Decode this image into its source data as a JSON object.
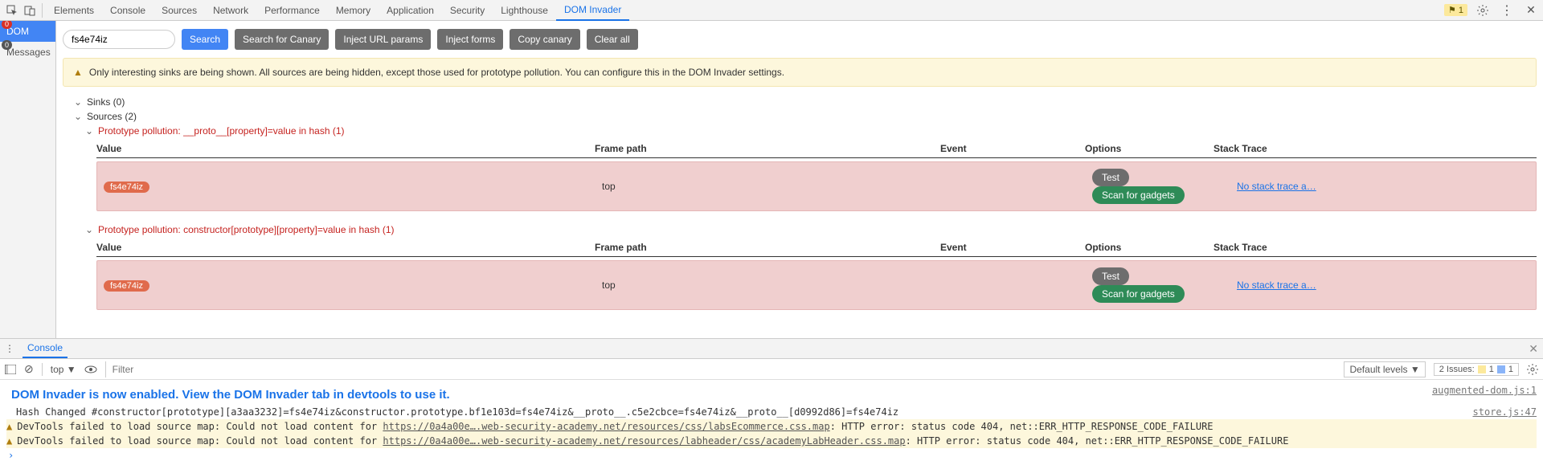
{
  "tabs": [
    "Elements",
    "Console",
    "Sources",
    "Network",
    "Performance",
    "Memory",
    "Application",
    "Security",
    "Lighthouse",
    "DOM Invader"
  ],
  "active_tab": "DOM Invader",
  "top_badge": "1",
  "sidebar": {
    "dom": {
      "label": "DOM",
      "badge": "0"
    },
    "messages": {
      "label": "Messages",
      "badge": "0"
    }
  },
  "toolbar": {
    "search_value": "fs4e74iz",
    "search_label": "Search",
    "canary_label": "Search for Canary",
    "inject_url_label": "Inject URL params",
    "inject_forms_label": "Inject forms",
    "copy_canary_label": "Copy canary",
    "clear_label": "Clear all"
  },
  "banner": "Only interesting sinks are being shown. All sources are being hidden, except those used for prototype pollution. You can configure this in the DOM Invader settings.",
  "tree": {
    "sinks": "Sinks (0)",
    "sources": "Sources (2)",
    "pp1": "Prototype pollution: __proto__[property]=value in hash (1)",
    "pp2": "Prototype pollution: constructor[prototype][property]=value in hash (1)"
  },
  "cols": {
    "value": "Value",
    "frame": "Frame path",
    "event": "Event",
    "options": "Options",
    "trace": "Stack Trace"
  },
  "rows": [
    {
      "value": "fs4e74iz",
      "frame": "top",
      "test": "Test",
      "scan": "Scan for gadgets",
      "trace": "No stack trace a…"
    },
    {
      "value": "fs4e74iz",
      "frame": "top",
      "test": "Test",
      "scan": "Scan for gadgets",
      "trace": "No stack trace a…"
    }
  ],
  "drawer": {
    "console_tab": "Console"
  },
  "console_toolbar": {
    "top": "top ▼",
    "filter_placeholder": "Filter",
    "levels": "Default levels ▼",
    "issues_label": "2 Issues:",
    "issue_y": "1",
    "issue_b": "1"
  },
  "console": {
    "headline": "DOM Invader is now enabled. View the DOM Invader tab in devtools to use it.",
    "headline_src": "augmented-dom.js:1",
    "hash": "Hash Changed #constructor[prototype][a3aa3232]=fs4e74iz&constructor.prototype.bf1e103d=fs4e74iz&__proto__.c5e2cbce=fs4e74iz&__proto__[d0992d86]=fs4e74iz",
    "hash_src": "store.js:47",
    "w1_pre": "DevTools failed to load source map: Could not load content for ",
    "w1_link": "https://0a4a00e….web-security-academy.net/resources/css/labsEcommerce.css.map",
    "w1_post": ": HTTP error: status code 404, net::ERR_HTTP_RESPONSE_CODE_FAILURE",
    "w2_pre": "DevTools failed to load source map: Could not load content for ",
    "w2_link": "https://0a4a00e….web-security-academy.net/resources/labheader/css/academyLabHeader.css.map",
    "w2_post": ": HTTP error: status code 404, net::ERR_HTTP_RESPONSE_CODE_FAILURE"
  }
}
